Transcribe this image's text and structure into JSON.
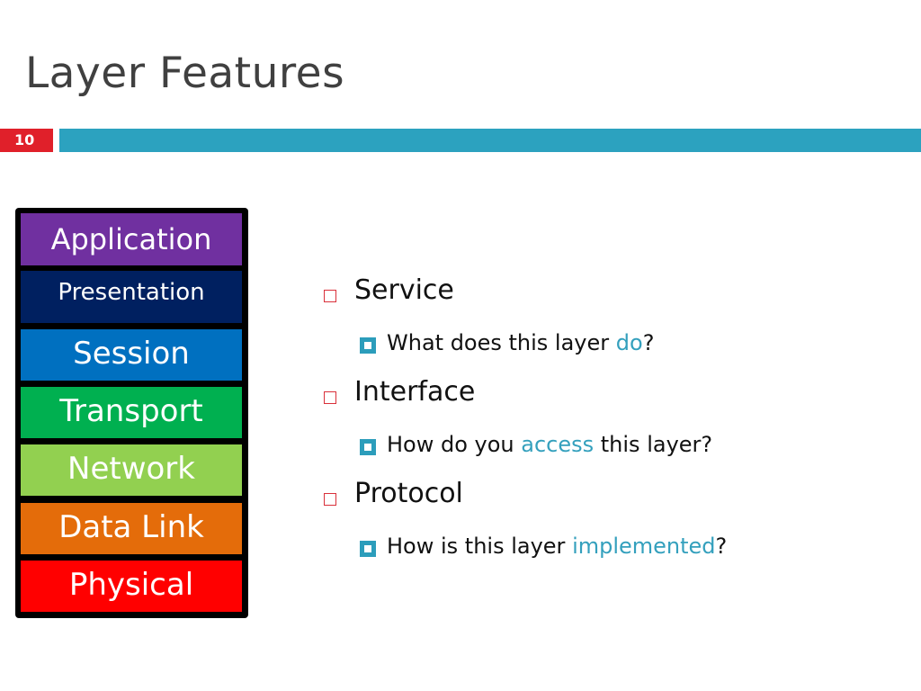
{
  "slide": {
    "title": "Layer Features",
    "number": "10",
    "colors": {
      "slide_number_bg": "#e0202a",
      "rule_bar": "#2ca2bf",
      "bullet_l1": "#d9303a",
      "bullet_l2": "#2c9dbb",
      "highlight": "#34a0bd"
    }
  },
  "osi_stack": {
    "layers": [
      {
        "label": "Application",
        "color": "#7030a0"
      },
      {
        "label": "Presentation",
        "color": "#002060"
      },
      {
        "label": "Session",
        "color": "#0070c0"
      },
      {
        "label": "Transport",
        "color": "#00b050"
      },
      {
        "label": "Network",
        "color": "#92d050"
      },
      {
        "label": "Data Link",
        "color": "#e46c0a"
      },
      {
        "label": "Physical",
        "color": "#ff0000"
      }
    ]
  },
  "bullets": [
    {
      "heading": "Service",
      "sub": {
        "before": "What does this layer ",
        "highlight": "do",
        "after": "?"
      }
    },
    {
      "heading": "Interface",
      "sub": {
        "before": "How do you ",
        "highlight": "access",
        "after": " this layer?"
      }
    },
    {
      "heading": "Protocol",
      "sub": {
        "before": "How is this layer ",
        "highlight": "implemented",
        "after": "?"
      }
    }
  ]
}
